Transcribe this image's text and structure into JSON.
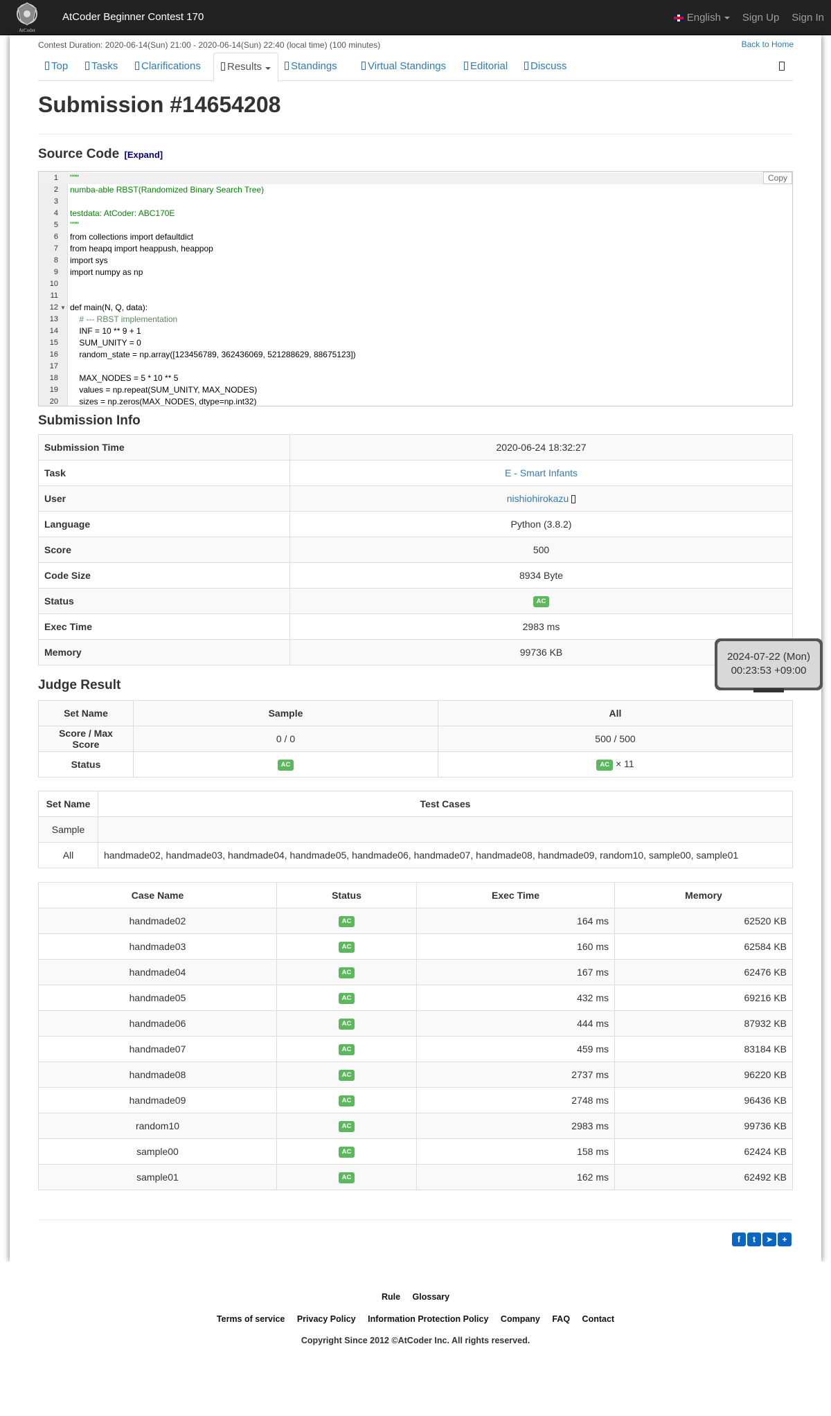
{
  "navbar": {
    "brand": "AtCoder Beginner Contest 170",
    "logo_text": "AtCoder",
    "language": "English",
    "sign_up": "Sign Up",
    "sign_in": "Sign In"
  },
  "contest": {
    "duration": "Contest Duration: 2020-06-14(Sun) 21:00 - 2020-06-14(Sun) 22:40 (local time) (100 minutes)",
    "back_home": "Back to Home"
  },
  "tabs": [
    {
      "label": "Top"
    },
    {
      "label": "Tasks"
    },
    {
      "label": "Clarifications"
    },
    {
      "label": "Results"
    },
    {
      "label": "Standings"
    },
    {
      "label": "Virtual Standings"
    },
    {
      "label": "Editorial"
    },
    {
      "label": "Discuss"
    }
  ],
  "page_title": "Submission #14654208",
  "source_code": {
    "heading": "Source Code",
    "expand": "[Expand]",
    "copy": "Copy",
    "lines": [
      {
        "n": "1",
        "text": "\"\"\""
      },
      {
        "n": "2",
        "text": "numba-able RBST(Randomized Binary Search Tree)"
      },
      {
        "n": "3",
        "text": ""
      },
      {
        "n": "4",
        "text": "testdata: AtCoder: ABC170E"
      },
      {
        "n": "5",
        "text": "\"\"\""
      },
      {
        "n": "6",
        "text": "from collections import defaultdict"
      },
      {
        "n": "7",
        "text": "from heapq import heappush, heappop"
      },
      {
        "n": "8",
        "text": "import sys"
      },
      {
        "n": "9",
        "text": "import numpy as np"
      },
      {
        "n": "10",
        "text": ""
      },
      {
        "n": "11",
        "text": ""
      },
      {
        "n": "12",
        "text": "def main(N, Q, data):"
      },
      {
        "n": "13",
        "text": "    # --- RBST implementation"
      },
      {
        "n": "14",
        "text": "    INF = 10 ** 9 + 1"
      },
      {
        "n": "15",
        "text": "    SUM_UNITY = 0"
      },
      {
        "n": "16",
        "text": "    random_state = np.array([123456789, 362436069, 521288629, 88675123])"
      },
      {
        "n": "17",
        "text": ""
      },
      {
        "n": "18",
        "text": "    MAX_NODES = 5 * 10 ** 5"
      },
      {
        "n": "19",
        "text": "    values = np.repeat(SUM_UNITY, MAX_NODES)"
      },
      {
        "n": "20",
        "text": "    sizes = np.zeros(MAX_NODES, dtype=np.int32)"
      }
    ]
  },
  "submission_info": {
    "heading": "Submission Info",
    "rows": [
      {
        "label": "Submission Time",
        "value": "2020-06-24 18:32:27"
      },
      {
        "label": "Task",
        "value": "E - Smart Infants"
      },
      {
        "label": "User",
        "value": "nishiohirokazu"
      },
      {
        "label": "Language",
        "value": "Python (3.8.2)"
      },
      {
        "label": "Score",
        "value": "500"
      },
      {
        "label": "Code Size",
        "value": "8934 Byte"
      },
      {
        "label": "Status",
        "value": "AC"
      },
      {
        "label": "Exec Time",
        "value": "2983 ms"
      },
      {
        "label": "Memory",
        "value": "99736 KB"
      }
    ]
  },
  "clock_tooltip": {
    "date": "2024-07-22 (Mon)",
    "time": "00:23:53 +09:00"
  },
  "judge_result": {
    "heading": "Judge Result",
    "col_set": "Set Name",
    "col_sample": "Sample",
    "col_all": "All",
    "score_label": "Score / Max Score",
    "sample_score": "0 / 0",
    "all_score": "500 / 500",
    "status_label": "Status",
    "sample_status": "AC",
    "all_status": "AC",
    "all_count": "× 11"
  },
  "test_sets": {
    "col_set": "Set Name",
    "col_cases": "Test Cases",
    "rows": [
      {
        "set": "Sample",
        "cases": ""
      },
      {
        "set": "All",
        "cases": "handmade02, handmade03, handmade04, handmade05, handmade06, handmade07, handmade08, handmade09, random10, sample00, sample01"
      }
    ]
  },
  "cases": {
    "col_name": "Case Name",
    "col_status": "Status",
    "col_time": "Exec Time",
    "col_memory": "Memory",
    "rows": [
      {
        "name": "handmade02",
        "status": "AC",
        "time": "164 ms",
        "memory": "62520 KB"
      },
      {
        "name": "handmade03",
        "status": "AC",
        "time": "160 ms",
        "memory": "62584 KB"
      },
      {
        "name": "handmade04",
        "status": "AC",
        "time": "167 ms",
        "memory": "62476 KB"
      },
      {
        "name": "handmade05",
        "status": "AC",
        "time": "432 ms",
        "memory": "69216 KB"
      },
      {
        "name": "handmade06",
        "status": "AC",
        "time": "444 ms",
        "memory": "87932 KB"
      },
      {
        "name": "handmade07",
        "status": "AC",
        "time": "459 ms",
        "memory": "83184 KB"
      },
      {
        "name": "handmade08",
        "status": "AC",
        "time": "2737 ms",
        "memory": "96220 KB"
      },
      {
        "name": "handmade09",
        "status": "AC",
        "time": "2748 ms",
        "memory": "96436 KB"
      },
      {
        "name": "random10",
        "status": "AC",
        "time": "2983 ms",
        "memory": "99736 KB"
      },
      {
        "name": "sample00",
        "status": "AC",
        "time": "158 ms",
        "memory": "62424 KB"
      },
      {
        "name": "sample01",
        "status": "AC",
        "time": "162 ms",
        "memory": "62492 KB"
      }
    ]
  },
  "footer": {
    "rule": "Rule",
    "glossary": "Glossary",
    "terms": "Terms of service",
    "privacy": "Privacy Policy",
    "info_protection": "Information Protection Policy",
    "company": "Company",
    "faq": "FAQ",
    "contact": "Contact",
    "copyright": "Copyright Since 2012 ©AtCoder Inc. All rights reserved."
  }
}
